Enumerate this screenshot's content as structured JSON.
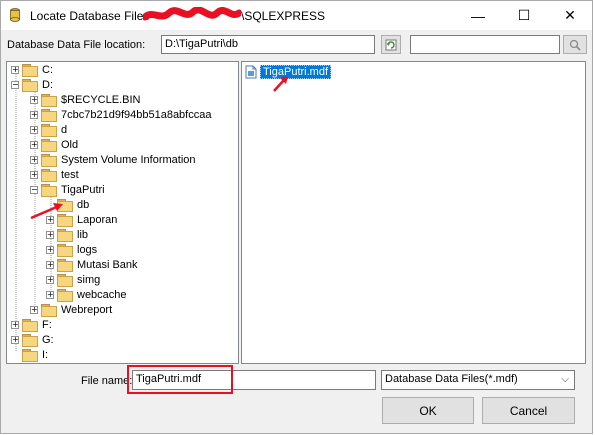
{
  "window": {
    "title_prefix": "Locate Database Files - ",
    "title_suffix": "\\SQLEXPRESS",
    "minimize_glyph": "—",
    "maximize_glyph": "☐",
    "close_glyph": "✕"
  },
  "location": {
    "label": "Database Data File location:",
    "value": "D:\\TigaPutri\\db",
    "search_value": ""
  },
  "tree": {
    "drives": [
      {
        "label": "C:"
      },
      {
        "label": "D:"
      }
    ],
    "d_children": [
      {
        "label": "$RECYCLE.BIN"
      },
      {
        "label": "7cbc7b21d9f94bb51a8abfccaa"
      },
      {
        "label": "d"
      },
      {
        "label": "Old"
      },
      {
        "label": "System Volume Information"
      },
      {
        "label": "test"
      },
      {
        "label": "TigaPutri"
      }
    ],
    "tigaputri_children": [
      {
        "label": "db"
      },
      {
        "label": "Laporan"
      },
      {
        "label": "lib"
      },
      {
        "label": "logs"
      },
      {
        "label": "Mutasi Bank"
      },
      {
        "label": "simg"
      },
      {
        "label": "webcache"
      }
    ],
    "after": [
      {
        "label": "Webreport"
      },
      {
        "label": "F:"
      },
      {
        "label": "G:"
      },
      {
        "label": "I:"
      }
    ]
  },
  "files": [
    {
      "label": "TigaPutri.mdf",
      "selected": true
    }
  ],
  "footer": {
    "filename_label": "File name:",
    "filename_value": "TigaPutri.mdf",
    "filter_value": "Database Data Files(*.mdf)",
    "ok_label": "OK",
    "cancel_label": "Cancel"
  },
  "colors": {
    "selection": "#0078d7",
    "annotation": "#e81123",
    "folder": "#f6d67f"
  }
}
